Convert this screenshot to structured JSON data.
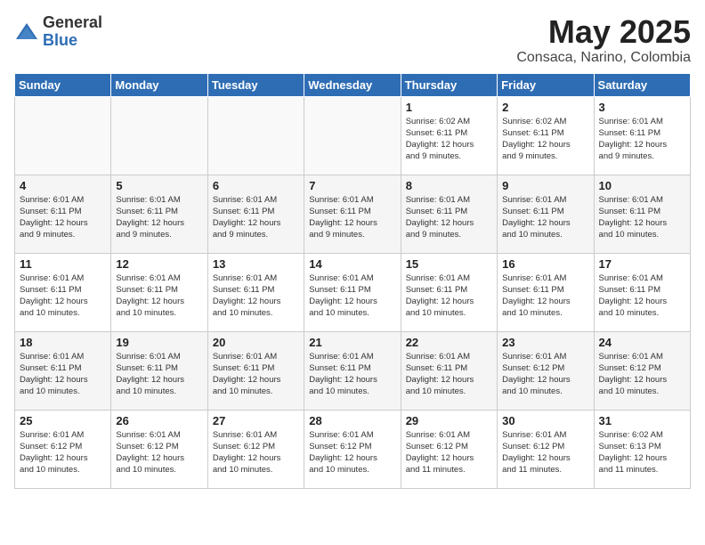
{
  "logo": {
    "general": "General",
    "blue": "Blue"
  },
  "header": {
    "month": "May 2025",
    "location": "Consaca, Narino, Colombia"
  },
  "weekdays": [
    "Sunday",
    "Monday",
    "Tuesday",
    "Wednesday",
    "Thursday",
    "Friday",
    "Saturday"
  ],
  "weeks": [
    [
      {
        "day": "",
        "info": ""
      },
      {
        "day": "",
        "info": ""
      },
      {
        "day": "",
        "info": ""
      },
      {
        "day": "",
        "info": ""
      },
      {
        "day": "1",
        "info": "Sunrise: 6:02 AM\nSunset: 6:11 PM\nDaylight: 12 hours\nand 9 minutes."
      },
      {
        "day": "2",
        "info": "Sunrise: 6:02 AM\nSunset: 6:11 PM\nDaylight: 12 hours\nand 9 minutes."
      },
      {
        "day": "3",
        "info": "Sunrise: 6:01 AM\nSunset: 6:11 PM\nDaylight: 12 hours\nand 9 minutes."
      }
    ],
    [
      {
        "day": "4",
        "info": "Sunrise: 6:01 AM\nSunset: 6:11 PM\nDaylight: 12 hours\nand 9 minutes."
      },
      {
        "day": "5",
        "info": "Sunrise: 6:01 AM\nSunset: 6:11 PM\nDaylight: 12 hours\nand 9 minutes."
      },
      {
        "day": "6",
        "info": "Sunrise: 6:01 AM\nSunset: 6:11 PM\nDaylight: 12 hours\nand 9 minutes."
      },
      {
        "day": "7",
        "info": "Sunrise: 6:01 AM\nSunset: 6:11 PM\nDaylight: 12 hours\nand 9 minutes."
      },
      {
        "day": "8",
        "info": "Sunrise: 6:01 AM\nSunset: 6:11 PM\nDaylight: 12 hours\nand 9 minutes."
      },
      {
        "day": "9",
        "info": "Sunrise: 6:01 AM\nSunset: 6:11 PM\nDaylight: 12 hours\nand 10 minutes."
      },
      {
        "day": "10",
        "info": "Sunrise: 6:01 AM\nSunset: 6:11 PM\nDaylight: 12 hours\nand 10 minutes."
      }
    ],
    [
      {
        "day": "11",
        "info": "Sunrise: 6:01 AM\nSunset: 6:11 PM\nDaylight: 12 hours\nand 10 minutes."
      },
      {
        "day": "12",
        "info": "Sunrise: 6:01 AM\nSunset: 6:11 PM\nDaylight: 12 hours\nand 10 minutes."
      },
      {
        "day": "13",
        "info": "Sunrise: 6:01 AM\nSunset: 6:11 PM\nDaylight: 12 hours\nand 10 minutes."
      },
      {
        "day": "14",
        "info": "Sunrise: 6:01 AM\nSunset: 6:11 PM\nDaylight: 12 hours\nand 10 minutes."
      },
      {
        "day": "15",
        "info": "Sunrise: 6:01 AM\nSunset: 6:11 PM\nDaylight: 12 hours\nand 10 minutes."
      },
      {
        "day": "16",
        "info": "Sunrise: 6:01 AM\nSunset: 6:11 PM\nDaylight: 12 hours\nand 10 minutes."
      },
      {
        "day": "17",
        "info": "Sunrise: 6:01 AM\nSunset: 6:11 PM\nDaylight: 12 hours\nand 10 minutes."
      }
    ],
    [
      {
        "day": "18",
        "info": "Sunrise: 6:01 AM\nSunset: 6:11 PM\nDaylight: 12 hours\nand 10 minutes."
      },
      {
        "day": "19",
        "info": "Sunrise: 6:01 AM\nSunset: 6:11 PM\nDaylight: 12 hours\nand 10 minutes."
      },
      {
        "day": "20",
        "info": "Sunrise: 6:01 AM\nSunset: 6:11 PM\nDaylight: 12 hours\nand 10 minutes."
      },
      {
        "day": "21",
        "info": "Sunrise: 6:01 AM\nSunset: 6:11 PM\nDaylight: 12 hours\nand 10 minutes."
      },
      {
        "day": "22",
        "info": "Sunrise: 6:01 AM\nSunset: 6:11 PM\nDaylight: 12 hours\nand 10 minutes."
      },
      {
        "day": "23",
        "info": "Sunrise: 6:01 AM\nSunset: 6:12 PM\nDaylight: 12 hours\nand 10 minutes."
      },
      {
        "day": "24",
        "info": "Sunrise: 6:01 AM\nSunset: 6:12 PM\nDaylight: 12 hours\nand 10 minutes."
      }
    ],
    [
      {
        "day": "25",
        "info": "Sunrise: 6:01 AM\nSunset: 6:12 PM\nDaylight: 12 hours\nand 10 minutes."
      },
      {
        "day": "26",
        "info": "Sunrise: 6:01 AM\nSunset: 6:12 PM\nDaylight: 12 hours\nand 10 minutes."
      },
      {
        "day": "27",
        "info": "Sunrise: 6:01 AM\nSunset: 6:12 PM\nDaylight: 12 hours\nand 10 minutes."
      },
      {
        "day": "28",
        "info": "Sunrise: 6:01 AM\nSunset: 6:12 PM\nDaylight: 12 hours\nand 10 minutes."
      },
      {
        "day": "29",
        "info": "Sunrise: 6:01 AM\nSunset: 6:12 PM\nDaylight: 12 hours\nand 11 minutes."
      },
      {
        "day": "30",
        "info": "Sunrise: 6:01 AM\nSunset: 6:12 PM\nDaylight: 12 hours\nand 11 minutes."
      },
      {
        "day": "31",
        "info": "Sunrise: 6:02 AM\nSunset: 6:13 PM\nDaylight: 12 hours\nand 11 minutes."
      }
    ]
  ]
}
